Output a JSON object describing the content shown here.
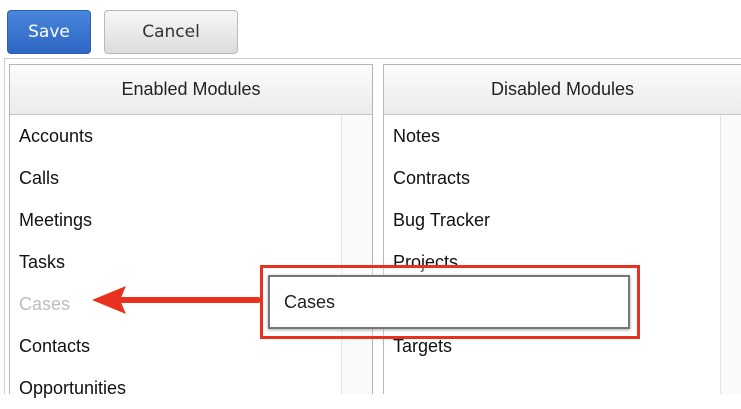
{
  "toolbar": {
    "save_label": "Save",
    "cancel_label": "Cancel"
  },
  "enabled": {
    "title": "Enabled Modules",
    "items": [
      "Accounts",
      "Calls",
      "Meetings",
      "Tasks",
      "Cases",
      "Contacts",
      "Opportunities"
    ]
  },
  "disabled": {
    "title": "Disabled Modules",
    "items": [
      "Notes",
      "Contracts",
      "Bug Tracker",
      "Projects",
      "",
      "Targets"
    ]
  },
  "drag": {
    "label": "Cases"
  },
  "colors": {
    "save_blue": "#2d66c4",
    "highlight_red": "#e8311f",
    "ghost_text": "#bdbdbd"
  },
  "annotation": {
    "arrow_icon": "left-arrow-icon"
  }
}
